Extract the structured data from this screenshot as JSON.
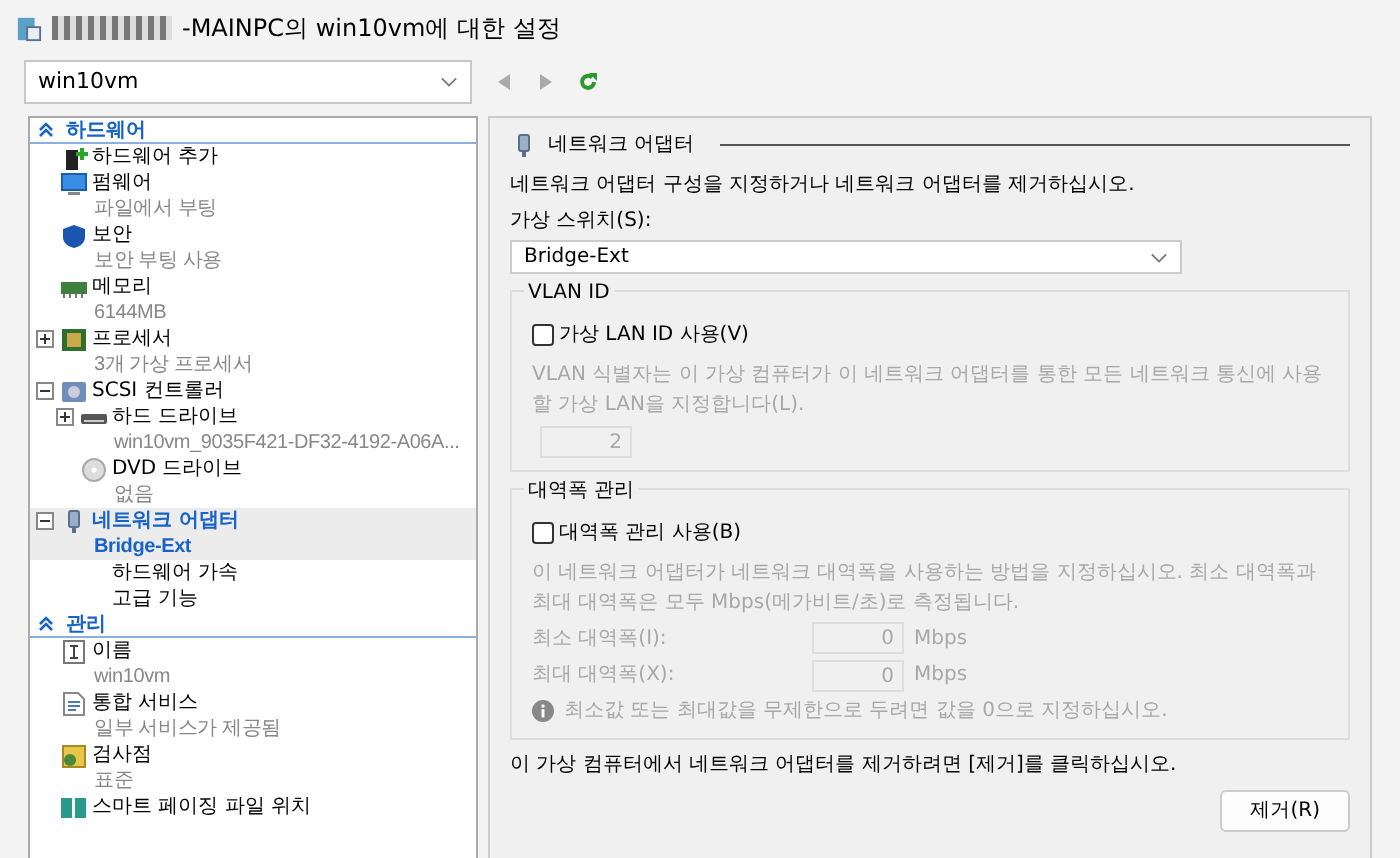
{
  "window": {
    "title": "-MAINPC의 win10vm에 대한 설정"
  },
  "toolbar": {
    "vm_select": "win10vm"
  },
  "sidebar": {
    "sections": [
      {
        "title": "하드웨어",
        "expanded": true,
        "items": [
          {
            "kind": "add-hardware",
            "label": "하드웨어 추가",
            "selected": false
          },
          {
            "kind": "monitor",
            "label": "펌웨어",
            "detail": "파일에서 부팅",
            "selected": false
          },
          {
            "kind": "shield",
            "label": "보안",
            "detail": "보안 부팅 사용",
            "selected": false
          },
          {
            "kind": "memory",
            "label": "메모리",
            "detail": "6144MB",
            "selected": false
          },
          {
            "kind": "chip",
            "label": "프로세서",
            "detail": "3개 가상 프로세서",
            "expanded": false,
            "selected": false
          },
          {
            "kind": "controller",
            "label": "SCSI 컨트롤러",
            "expanded": true,
            "selected": false,
            "children": [
              {
                "kind": "disk",
                "label": "하드 드라이브",
                "detail": "win10vm_9035F421-DF32-4192-A06A...",
                "expanded": false,
                "selected": false
              },
              {
                "kind": "dvd",
                "label": "DVD 드라이브",
                "detail": "없음",
                "selected": false
              }
            ]
          },
          {
            "kind": "plug",
            "label": "네트워크 어댑터",
            "detail": "Bridge-Ext",
            "expanded": true,
            "selected": true,
            "children": [
              {
                "label": "하드웨어 가속",
                "selected": false
              },
              {
                "label": "고급 기능",
                "selected": false
              }
            ]
          }
        ]
      },
      {
        "title": "관리",
        "expanded": true,
        "items": [
          {
            "kind": "name-tag",
            "label": "이름",
            "detail": "win10vm",
            "selected": false
          },
          {
            "kind": "document",
            "label": "통합 서비스",
            "detail": "일부 서비스가 제공됨",
            "selected": false
          },
          {
            "kind": "checkpoint",
            "label": "검사점",
            "detail": "표준",
            "selected": false
          },
          {
            "kind": "paging",
            "label": "스마트 페이징 파일 위치",
            "selected": false
          }
        ]
      }
    ]
  },
  "panel": {
    "title": "네트워크 어댑터",
    "description": "네트워크 어댑터 구성을 지정하거나 네트워크 어댑터를 제거하십시오.",
    "switch_label": "가상 스위치(S):",
    "switch_value": "Bridge-Ext",
    "vlan": {
      "legend": "VLAN ID",
      "checkbox": {
        "label": "가상 LAN ID 사용(V)",
        "checked": false
      },
      "description": "VLAN 식별자는 이 가상 컴퓨터가 이 네트워크 어댑터를 통한 모든 네트워크 통신에 사용할 가상 LAN을 지정합니다(L).",
      "value": "2"
    },
    "bandwidth": {
      "legend": "대역폭 관리",
      "checkbox": {
        "label": "대역폭 관리 사용(B)",
        "checked": false
      },
      "description": "이 네트워크 어댑터가 네트워크 대역폭을 사용하는 방법을 지정하십시오. 최소 대역폭과 최대 대역폭은 모두 Mbps(메가비트/초)로 측정됩니다.",
      "fields": [
        {
          "label": "최소 대역폭(I):",
          "value": "0",
          "unit": "Mbps"
        },
        {
          "label": "최대 대역폭(X):",
          "value": "0",
          "unit": "Mbps"
        }
      ],
      "note": "최소값 또는 최대값을 무제한으로 두려면 값을 0으로 지정하십시오."
    },
    "footer": "이 가상 컴퓨터에서 네트워크 어댑터를 제거하려면 [제거]를 클릭하십시오.",
    "remove_button": "제거(R)"
  }
}
